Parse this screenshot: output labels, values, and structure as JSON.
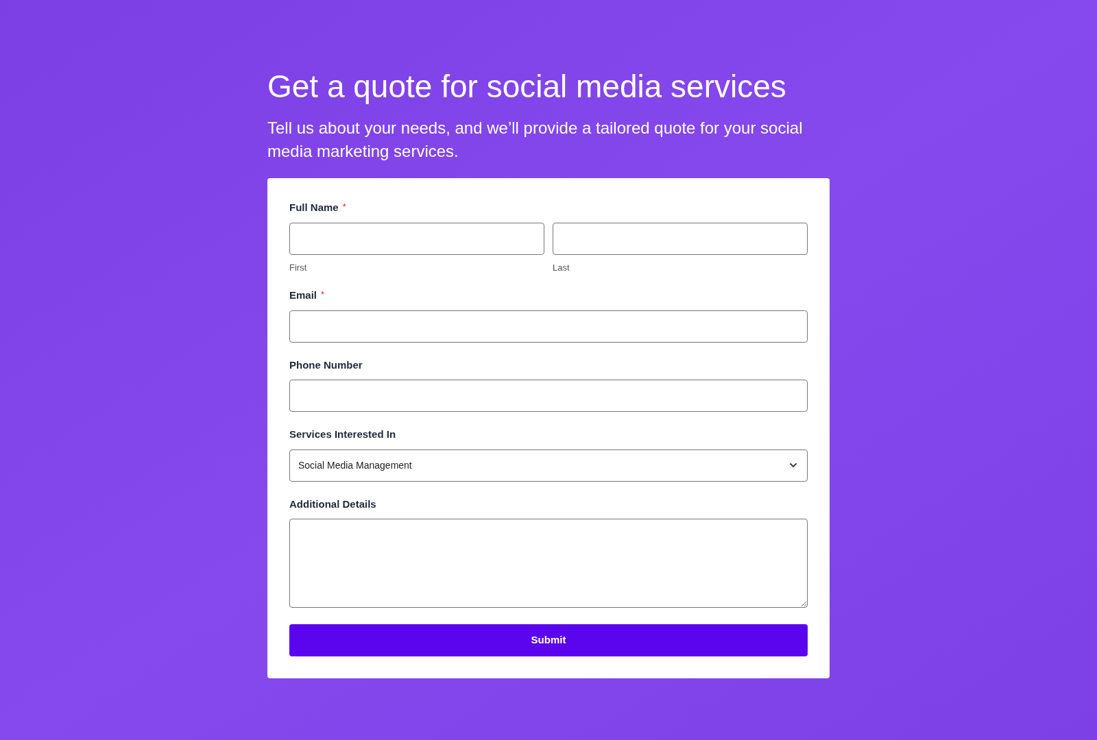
{
  "heading": "Get a quote for social media services",
  "subheading": "Tell us about your needs, and we’ll provide a tailored quote for your social media marketing services.",
  "form": {
    "fields": [
      {
        "kind": "name",
        "label": "Full Name",
        "required_mark": "*",
        "sublabels": [
          "First",
          "Last"
        ]
      },
      {
        "kind": "text",
        "label": "Email",
        "required_mark": "*"
      },
      {
        "kind": "text",
        "label": "Phone Number"
      },
      {
        "kind": "select",
        "label": "Services Interested In",
        "value": "Social Media Management"
      },
      {
        "kind": "textarea",
        "label": "Additional Details"
      }
    ],
    "submit": "Submit"
  }
}
